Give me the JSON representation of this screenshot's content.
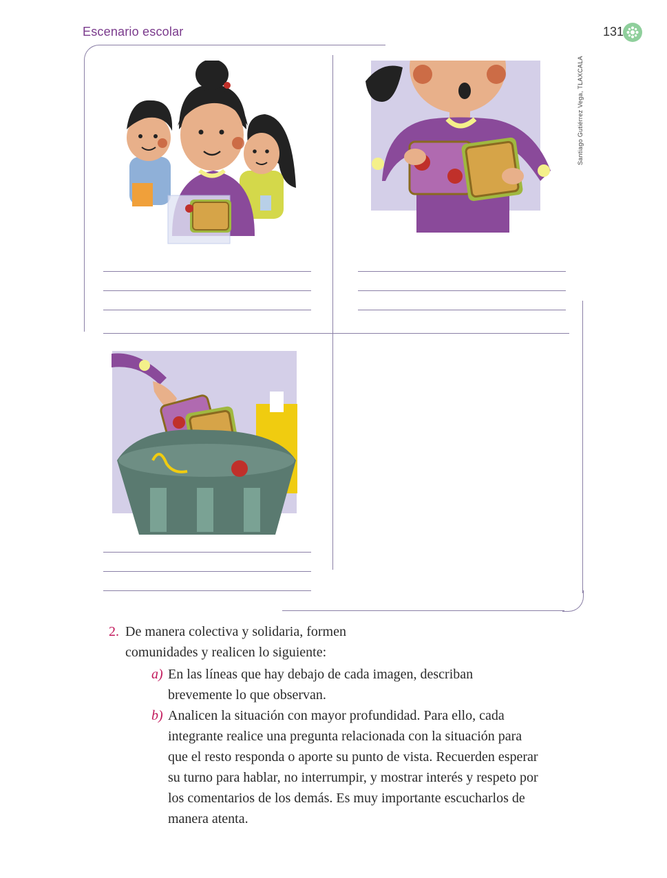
{
  "header": {
    "section_title": "Escenario escolar",
    "page_number": "131"
  },
  "credit": "Santiago Gutiérrez Vega, TLAXCALA",
  "illustrations": [
    {
      "name": "children-with-sandwich"
    },
    {
      "name": "girl-holding-sandwich"
    },
    {
      "name": "sandwich-thrown-in-trash"
    }
  ],
  "question": {
    "number": "2.",
    "intro_line1": "De manera colectiva y solidaria, formen",
    "intro_line2": "comunidades y realicen lo siguiente:",
    "items": [
      {
        "letter": "a)",
        "lines": [
          "En las líneas que hay debajo de cada imagen, describan",
          "brevemente lo que observan."
        ]
      },
      {
        "letter": "b)",
        "lines": [
          "Analicen la situación con mayor profundidad. Para ello, cada",
          "integrante realice una pregunta relacionada con la situación para",
          "que el resto responda o aporte su punto de vista. Recuerden esperar",
          "su turno para hablar, no interrumpir, y mostrar interés y respeto por",
          "los comentarios de los demás. Es muy importante escucharlos de",
          "manera atenta."
        ]
      }
    ]
  },
  "colors": {
    "accent_purple": "#7a3a8c",
    "accent_magenta": "#c2185b",
    "badge_green": "#8fcf9c",
    "frame_line": "#8a7fa6",
    "panel_bg": "#d4cfe8"
  }
}
